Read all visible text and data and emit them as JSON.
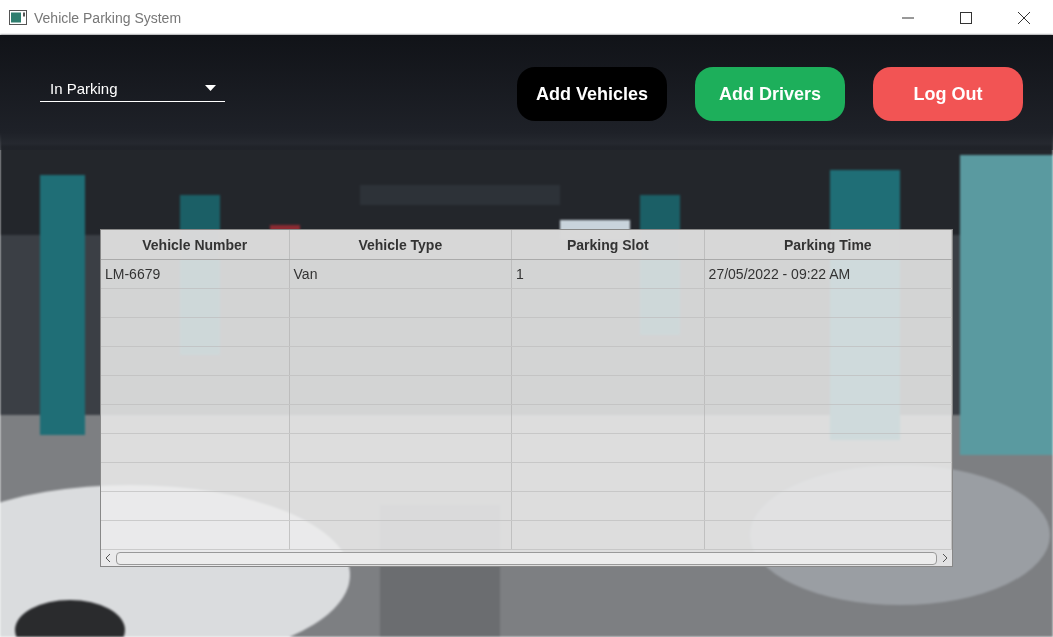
{
  "window": {
    "title": "Vehicle Parking System"
  },
  "filter": {
    "value": "In Parking"
  },
  "buttons": [
    {
      "label": "Add Vehicles",
      "color": "#000000"
    },
    {
      "label": "Add Drivers",
      "color": "#1daf5b"
    },
    {
      "label": "Log Out",
      "color": "#f25454"
    }
  ],
  "table": {
    "columns": [
      "Vehicle Number",
      "Vehicle Type",
      "Parking Slot",
      "Parking Time"
    ],
    "rows": [
      [
        "LM-6679",
        "Van",
        "1",
        "27/05/2022 - 09:22 AM"
      ]
    ]
  }
}
